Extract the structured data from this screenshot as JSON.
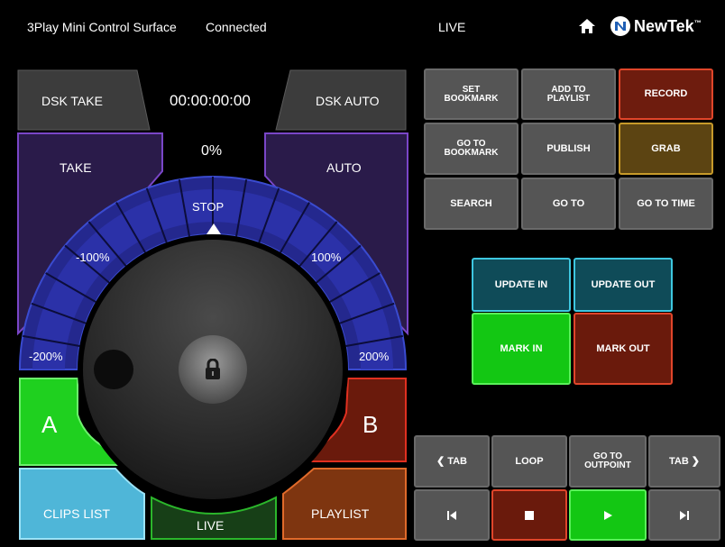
{
  "topbar": {
    "title": "3Play Mini Control Surface",
    "status": "Connected",
    "mode": "LIVE",
    "brand": "NewTek",
    "brand_tm": "™",
    "home_icon": "home-icon",
    "logo_icon": "newtek-logo-icon"
  },
  "left": {
    "dsk_take": "DSK TAKE",
    "timecode": "00:00:00:00",
    "dsk_auto": "DSK AUTO",
    "take": "TAKE",
    "percent": "0%",
    "auto": "AUTO",
    "stop": "STOP",
    "neg100": "-100%",
    "pos100": "100%",
    "neg200": "-200%",
    "pos200": "200%",
    "a": "A",
    "b": "B",
    "clips_list": "CLIPS LIST",
    "live": "LIVE",
    "playlist": "PLAYLIST"
  },
  "grid": {
    "set_bookmark_1": "SET",
    "set_bookmark_2": "BOOKMARK",
    "add_playlist_1": "ADD TO",
    "add_playlist_2": "PLAYLIST",
    "record": "RECORD",
    "goto_bookmark_1": "GO TO",
    "goto_bookmark_2": "BOOKMARK",
    "publish": "PUBLISH",
    "grab": "GRAB",
    "search": "SEARCH",
    "goto": "GO TO",
    "goto_time": "GO TO TIME"
  },
  "marks": {
    "update_in": "UPDATE IN",
    "update_out": "UPDATE OUT",
    "mark_in": "MARK IN",
    "mark_out": "MARK OUT"
  },
  "transport": {
    "tab_prev": "TAB",
    "loop": "LOOP",
    "goto_out_1": "GO TO",
    "goto_out_2": "OUTPOINT",
    "tab_next": "TAB"
  },
  "colors": {
    "accent_purple": "#7a46c8",
    "ring_blue": "#2a2fa0",
    "green": "#1fd01f",
    "dark_red": "#6a1a0c",
    "record_red": "#6e1c0e",
    "grab_gold": "#5c4412",
    "teal": "#0f4b58",
    "clips_blue": "#4fb6d8",
    "playlist_orange": "#7e3510"
  }
}
